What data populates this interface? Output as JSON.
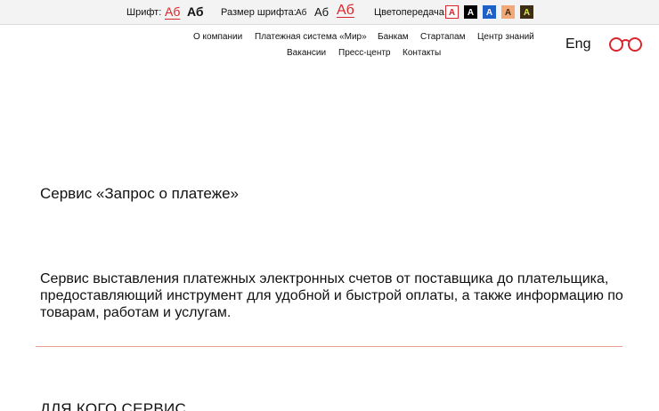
{
  "accessibility": {
    "font_label": "Шрифт:",
    "font_options": [
      "Аб",
      "Аб"
    ],
    "size_label": "Размер шрифта:",
    "size_options": [
      "Аб",
      "Аб",
      "Аб"
    ],
    "color_label": "Цветопередача:",
    "color_options": [
      "А",
      "А",
      "А",
      "А",
      "А"
    ],
    "color_schemes": [
      {
        "bg": "#ffffff",
        "fg": "#d9262c",
        "border": "#d9262c"
      },
      {
        "bg": "#000000",
        "fg": "#ffffff",
        "border": "#000000"
      },
      {
        "bg": "#1f5fc8",
        "fg": "#ffffff",
        "border": "#1f5fc8"
      },
      {
        "bg": "#f2a97a",
        "fg": "#3a2a10",
        "border": "#f2a97a"
      },
      {
        "bg": "#3c2d14",
        "fg": "#d6e84a",
        "border": "#3c2d14"
      }
    ]
  },
  "nav": {
    "row1": [
      "О компании",
      "Платежная система «Мир»",
      "Банкам",
      "Стартапам",
      "Центр знаний"
    ],
    "row2": [
      "Вакансии",
      "Пресс-центр",
      "Контакты"
    ],
    "lang": "Eng"
  },
  "main": {
    "title": "Сервис «Запрос о платеже»",
    "description": "Сервис выставления платежных электронных счетов от поставщика до плательщика, предоставляющий инструмент для удобной и быстрой оплаты, а также информацию по товарам, работам и услугам.",
    "section_title": "ДЛЯ КОГО СЕРВИС"
  },
  "colors": {
    "accent": "#d9262c",
    "divider": "#e8a090"
  }
}
